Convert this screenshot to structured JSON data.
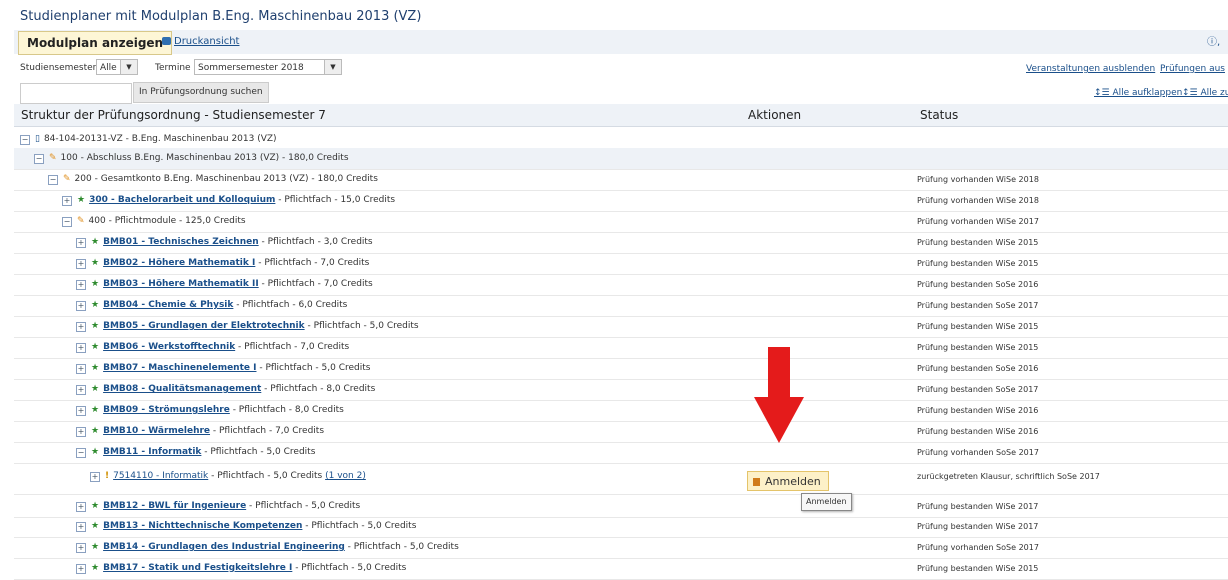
{
  "page_title": "Studienplaner mit Modulplan B.Eng. Maschinenbau 2013 (VZ)",
  "toolbar": {
    "modulplan_label": "Modulplan anzeigen",
    "druck_label": "Druckansicht",
    "info_icon_text": "ⓘ,"
  },
  "filters": {
    "semester_label": "Studiensemester",
    "semester_value": "Alle",
    "termine_label": "Termine",
    "termine_value": "Sommersemester 2018",
    "veranst_link": "Veranstaltungen ausblenden",
    "pruef_link": "Prüfungen aus"
  },
  "search": {
    "value": "",
    "button_label": "In Prüfungsordnung suchen"
  },
  "expand": {
    "all_open": "↕☰ Alle aufklappen",
    "all_close": "↕☰ Alle zu"
  },
  "table": {
    "col_structure": "Struktur der Prüfungsordnung - Studiensemester 7",
    "col_actions": "Aktionen",
    "col_status": "Status"
  },
  "tree": [
    {
      "link": "",
      "text": "84-104-20131-VZ - B.Eng. Maschinenbau 2013 (VZ)",
      "status": "",
      "icon": "document-icon"
    },
    {
      "link": "",
      "text": "100 - Abschluss B.Eng. Maschinenbau 2013 (VZ) - 180,0 Credits",
      "status": "",
      "icon": "tag-icon"
    },
    {
      "link": "",
      "text": "200 - Gesamtkonto B.Eng. Maschinenbau 2013 (VZ) - 180,0 Credits",
      "status": "Prüfung vorhanden  WiSe 2018",
      "icon": "tag-icon"
    },
    {
      "link": "300 - Bachelorarbeit und Kolloquium",
      "text": " - Pflichtfach - 15,0 Credits",
      "status": "Prüfung vorhanden  WiSe 2018",
      "icon": "star-icon"
    },
    {
      "link": "",
      "text": "400 - Pflichtmodule - 125,0 Credits",
      "status": "Prüfung vorhanden  WiSe 2017",
      "icon": "tag-icon"
    },
    {
      "link": "BMB01 - Technisches Zeichnen",
      "text": " - Pflichtfach - 3,0 Credits",
      "status": "Prüfung bestanden  WiSe 2015",
      "icon": "star-icon"
    },
    {
      "link": "BMB02 - Höhere Mathematik I",
      "text": " - Pflichtfach - 7,0 Credits",
      "status": "Prüfung bestanden  WiSe 2015",
      "icon": "star-icon"
    },
    {
      "link": "BMB03 - Höhere Mathematik II",
      "text": " - Pflichtfach - 7,0 Credits",
      "status": "Prüfung bestanden  SoSe 2016",
      "icon": "star-icon"
    },
    {
      "link": "BMB04 - Chemie & Physik",
      "text": " - Pflichtfach - 6,0 Credits",
      "status": "Prüfung bestanden  SoSe 2017",
      "icon": "star-icon"
    },
    {
      "link": "BMB05 - Grundlagen der Elektrotechnik",
      "text": " - Pflichtfach - 5,0 Credits",
      "status": "Prüfung bestanden  WiSe 2015",
      "icon": "star-icon"
    },
    {
      "link": "BMB06 - Werkstofftechnik",
      "text": " - Pflichtfach - 7,0 Credits",
      "status": "Prüfung bestanden  WiSe 2015",
      "icon": "star-icon"
    },
    {
      "link": "BMB07 - Maschinenelemente I",
      "text": " - Pflichtfach - 5,0 Credits",
      "status": "Prüfung bestanden  SoSe 2016",
      "icon": "star-icon"
    },
    {
      "link": "BMB08 - Qualitätsmanagement",
      "text": " - Pflichtfach - 8,0 Credits",
      "status": "Prüfung bestanden  SoSe 2017",
      "icon": "star-icon"
    },
    {
      "link": "BMB09 - Strömungslehre",
      "text": " - Pflichtfach - 8,0 Credits",
      "status": "Prüfung bestanden  WiSe 2016",
      "icon": "star-icon"
    },
    {
      "link": "BMB10 - Wärmelehre",
      "text": " - Pflichtfach - 7,0 Credits",
      "status": "Prüfung bestanden  WiSe 2016",
      "icon": "star-icon"
    },
    {
      "link": "BMB11 - Informatik",
      "text": " - Pflichtfach - 5,0 Credits",
      "status": "Prüfung vorhanden  SoSe 2017",
      "icon": "star-icon"
    },
    {
      "link": "7514110 - Informatik",
      "text": " - Pflichtfach - 5,0 Credits ",
      "extra": "(1 von 2)",
      "status": "zurückgetreten Klausur, schriftlich  SoSe 2017",
      "icon": "exclamation-icon"
    },
    {
      "link": "BMB12 - BWL für Ingenieure",
      "text": " - Pflichtfach - 5,0 Credits",
      "status": "Prüfung bestanden  WiSe 2017",
      "icon": "star-icon"
    },
    {
      "link": "BMB13 - Nichttechnische Kompetenzen",
      "text": " - Pflichtfach - 5,0 Credits",
      "status": "Prüfung bestanden  WiSe 2017",
      "icon": "star-icon"
    },
    {
      "link": "BMB14 - Grundlagen des Industrial Engineering",
      "text": " - Pflichtfach - 5,0 Credits",
      "status": "Prüfung vorhanden  SoSe 2017",
      "icon": "star-icon"
    },
    {
      "link": "BMB17 - Statik und Festigkeitslehre I",
      "text": " - Pflichtfach - 5,0 Credits",
      "status": "Prüfung bestanden  WiSe 2015",
      "icon": "star-icon"
    }
  ],
  "action": {
    "anmelden_label": "Anmelden",
    "tooltip": "Anmelden"
  },
  "colors": {
    "link": "#1a4f8a",
    "arrow": "#e41b1b",
    "star": "#2e8b2e"
  }
}
